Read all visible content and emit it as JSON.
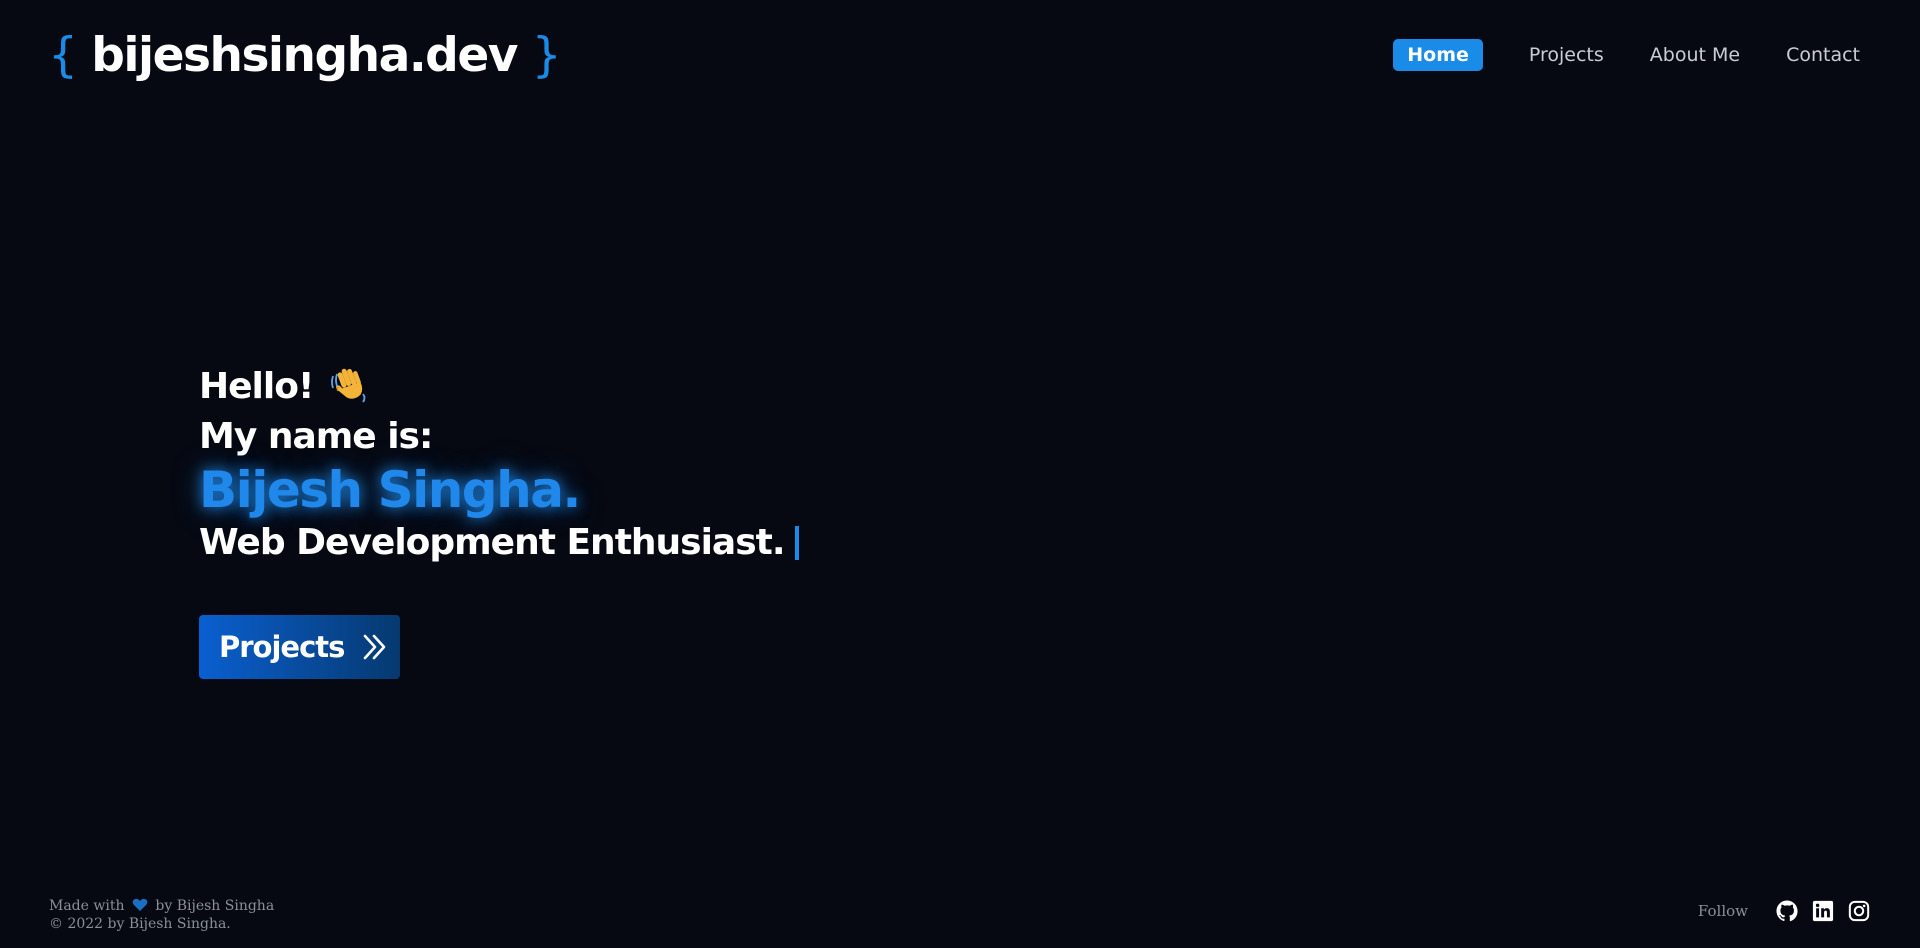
{
  "header": {
    "logo_open": "{",
    "logo_text": "bijeshsingha.dev",
    "logo_close": "}",
    "nav": [
      {
        "label": "Home"
      },
      {
        "label": "Projects"
      },
      {
        "label": "About Me"
      },
      {
        "label": "Contact"
      }
    ]
  },
  "hero": {
    "greeting": "Hello!",
    "intro": "My name is:",
    "name": "Bijesh Singha.",
    "tagline": "Web Development Enthusiast.",
    "cta_label": "Projects"
  },
  "footer": {
    "made_with_prefix": "Made with",
    "made_with_suffix": "by Bijesh Singha",
    "copyright": "© 2022 by Bijesh Singha.",
    "follow_label": "Follow"
  },
  "icons": {
    "wave": "waving-hand-icon",
    "cta": "double-chevron-right-icon",
    "heart": "heart-icon",
    "github": "github-icon",
    "linkedin": "linkedin-icon",
    "instagram": "instagram-icon"
  },
  "colors": {
    "background": "#060912",
    "accent": "#1a8ce8",
    "text": "#ffffff",
    "muted": "#8a8f99"
  }
}
